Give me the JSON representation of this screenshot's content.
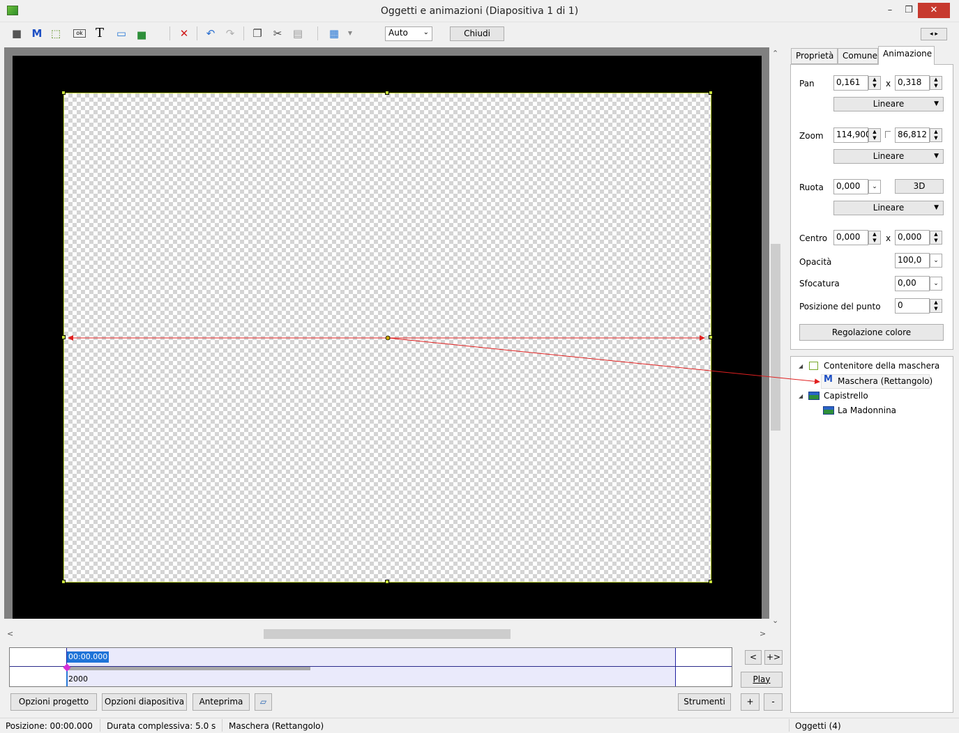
{
  "window": {
    "title": "Oggetti e animazioni  (Diapositiva 1 di 1)",
    "min_glyph": "–",
    "restore_glyph": "❐",
    "close_glyph": "✕"
  },
  "toolbar": {
    "zoom_value": "Auto",
    "close_label": "Chiudi",
    "tools": [
      {
        "icon": "camera-icon",
        "glyph": "■"
      },
      {
        "icon": "mask-icon",
        "glyph": "M"
      },
      {
        "icon": "frame-icon",
        "glyph": "⬚"
      },
      {
        "icon": "button-icon",
        "glyph": "ok"
      },
      {
        "icon": "text-icon",
        "glyph": "T"
      },
      {
        "icon": "rectangle-icon",
        "glyph": "▭"
      },
      {
        "icon": "image-icon",
        "glyph": "▅"
      },
      {
        "icon": "delete-icon",
        "glyph": "✕"
      },
      {
        "icon": "undo-icon",
        "glyph": "↶"
      },
      {
        "icon": "redo-icon",
        "glyph": "↷"
      },
      {
        "icon": "copy-icon",
        "glyph": "❐"
      },
      {
        "icon": "cut-icon",
        "glyph": "✂"
      },
      {
        "icon": "paste-icon",
        "glyph": "▤"
      },
      {
        "icon": "grid-icon",
        "glyph": "▦"
      }
    ]
  },
  "timeline": {
    "time": "00:00.000",
    "duration_marker": "2000",
    "prev_label": "<",
    "next_label": "+>",
    "play_label": "Play"
  },
  "bottom_buttons": {
    "project_options": "Opzioni progetto",
    "slide_options": "Opzioni diapositiva",
    "preview": "Anteprima",
    "tools": "Strumenti",
    "plus": "+",
    "minus": "-"
  },
  "statusbar": {
    "position": "Posizione:  00:00.000",
    "duration": "Durata complessiva:  5.0 s",
    "selected": "Maschera (Rettangolo)",
    "objects": "Oggetti (4)"
  },
  "tabs": {
    "properties": "Proprietà",
    "common": "Comune",
    "animation": "Animazione"
  },
  "animation": {
    "pan_label": "Pan",
    "pan_x": "0,161",
    "pan_y": "0,318",
    "pan_interp": "Lineare",
    "zoom_label": "Zoom",
    "zoom_x": "114,900",
    "zoom_y": "86,812",
    "zoom_interp": "Lineare",
    "rotate_label": "Ruota",
    "rotate_value": "0,000",
    "rotate_3d": "3D",
    "rotate_interp": "Lineare",
    "center_label": "Centro",
    "center_x": "0,000",
    "center_y": "0,000",
    "opacity_label": "Opacità",
    "opacity_value": "100,0",
    "blur_label": "Sfocatura",
    "blur_value": "0,00",
    "point_label": "Posizione del punto",
    "point_value": "0",
    "color_adjust": "Regolazione colore",
    "x_sep": "x"
  },
  "tree": {
    "items": [
      {
        "label": "Contenitore della maschera",
        "level": 0,
        "icon": "frame-icon"
      },
      {
        "label": "Maschera (Rettangolo)",
        "level": 1,
        "icon": "mask-icon"
      },
      {
        "label": "Capistrello",
        "level": 0,
        "icon": "image-icon"
      },
      {
        "label": "La Madonnina",
        "level": 1,
        "icon": "image-icon"
      }
    ]
  },
  "colors": {
    "selection_outline": "#c6e03a",
    "pan_arrow": "#e02020",
    "accent": "#1e73d8"
  }
}
